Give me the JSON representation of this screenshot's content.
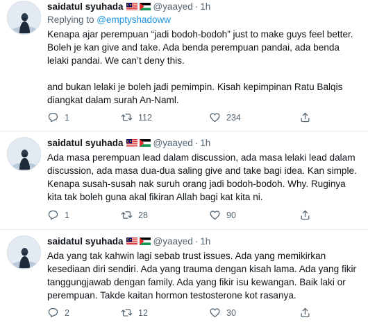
{
  "tweets": [
    {
      "name": "saidatul syuhada",
      "handle": "@yaayed",
      "dot": "·",
      "time": "1h",
      "replying_prefix": "Replying to ",
      "replying_handle": "@emptyshadoww",
      "text": "Kenapa ajar perempuan “jadi bodoh-bodoh” just to make guys feel better. Boleh je kan give and take. Ada benda perempuan pandai, ada benda lelaki pandai. We can’t deny this.\n\nand bukan lelaki je boleh jadi pemimpin. Kisah kepimpinan Ratu Balqis diangkat dalam surah An-Naml.",
      "replies": "1",
      "retweets": "112",
      "likes": "234"
    },
    {
      "name": "saidatul syuhada",
      "handle": "@yaayed",
      "dot": "·",
      "time": "1h",
      "text": "Ada masa perempuan lead dalam discussion, ada masa lelaki lead dalam discussion, ada masa dua-dua saling give and take bagi idea. Kan simple. Kenapa susah-susah nak suruh orang jadi bodoh-bodoh. Why. Ruginya kita tak boleh guna akal fikiran Allah bagi kat kita ni.",
      "replies": "1",
      "retweets": "28",
      "likes": "90"
    },
    {
      "name": "saidatul syuhada",
      "handle": "@yaayed",
      "dot": "·",
      "time": "1h",
      "text": "Ada yang tak kahwin lagi sebab trust issues. Ada yang memikirkan kesediaan diri sendiri. Ada yang trauma dengan kisah lama. Ada yang fikir tanggungjawab dengan family. Ada yang fikir isu kewangan. Baik laki or perempuan. Takde kaitan hormon testosterone kot rasanya.",
      "replies": "2",
      "retweets": "12",
      "likes": "30"
    }
  ],
  "icons": {
    "reply": "reply-icon",
    "retweet": "retweet-icon",
    "like": "heart-icon",
    "share": "share-icon",
    "flags": [
      "malaysia-flag-icon",
      "palestine-flag-icon"
    ]
  },
  "colors": {
    "text": "#0f1419",
    "secondary": "#536471",
    "link": "#1b95e0",
    "divider": "#e6ecf0"
  }
}
